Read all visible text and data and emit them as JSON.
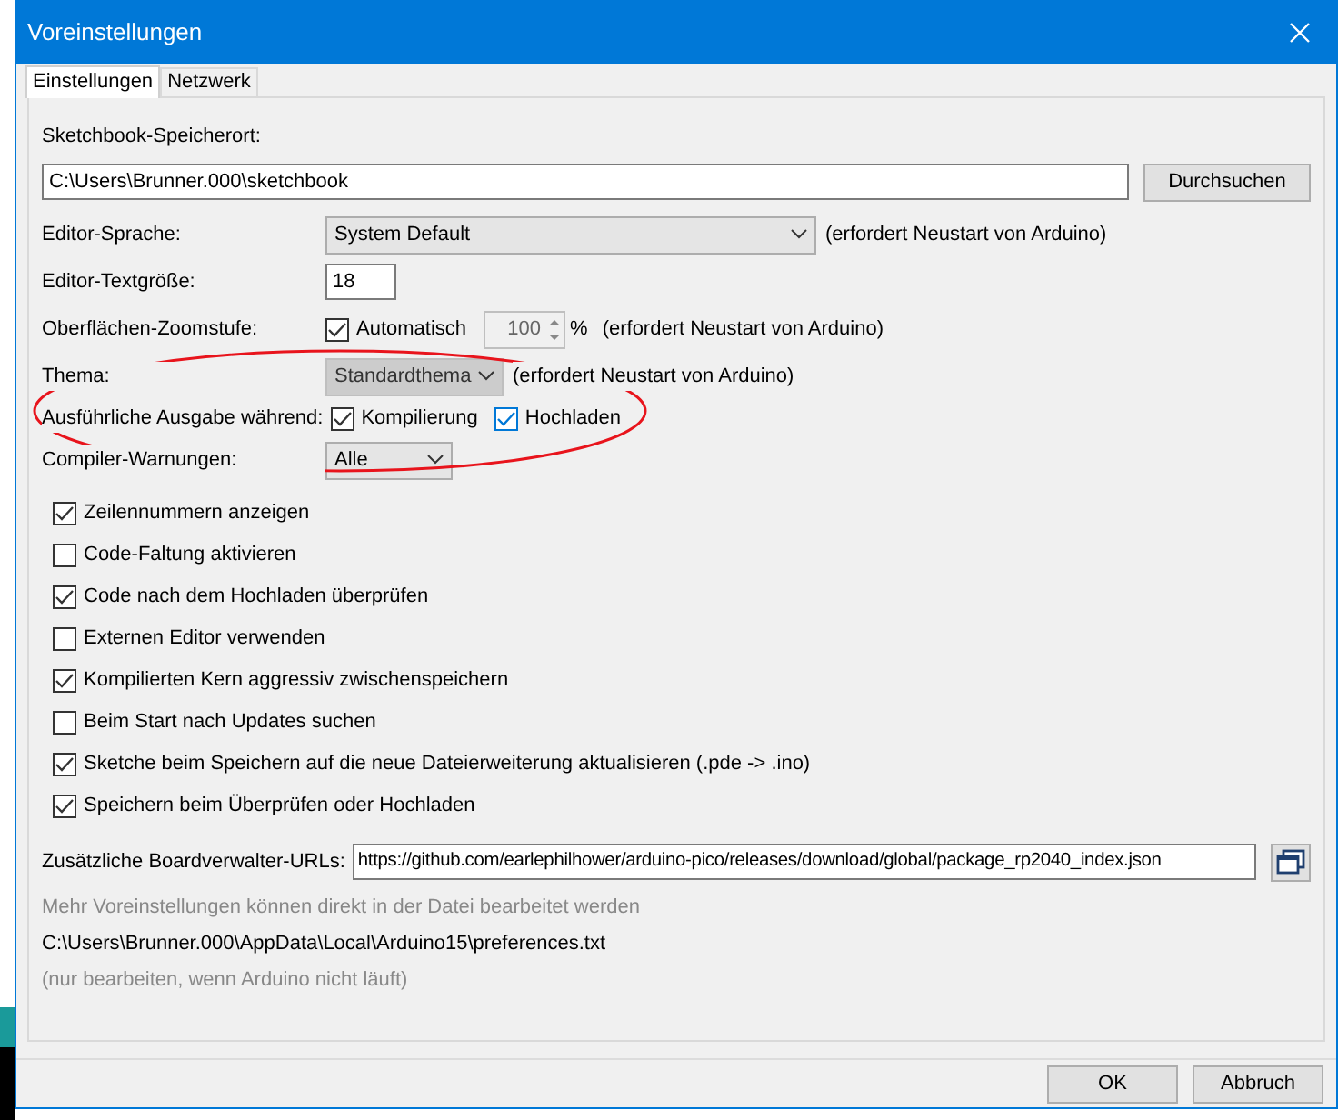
{
  "window": {
    "title": "Voreinstellungen"
  },
  "tabs": [
    {
      "label": "Einstellungen",
      "selected": true
    },
    {
      "label": "Netzwerk",
      "selected": false
    }
  ],
  "sketchbook": {
    "label": "Sketchbook-Speicherort:",
    "value": "C:\\Users\\Brunner.000\\sketchbook",
    "button": "Durchsuchen"
  },
  "rows": [
    {
      "kind": "select",
      "label": "Editor-Sprache:",
      "value": "System Default",
      "disabled": false,
      "note": "(erfordert Neustart von Arduino)"
    },
    {
      "kind": "text",
      "label": "Editor-Textgröße:",
      "value": "18"
    },
    {
      "kind": "zoom",
      "label": "Oberflächen-Zoomstufe:",
      "check": {
        "label": "Automatisch",
        "checked": true
      },
      "value": "100",
      "unit": "%",
      "note": "(erfordert Neustart von Arduino)"
    },
    {
      "kind": "select",
      "label": "Thema:",
      "value": "Standardthema",
      "disabled": true,
      "note": "(erfordert Neustart von Arduino)"
    },
    {
      "kind": "checks",
      "label": "Ausführliche Ausgabe während:",
      "checks": [
        {
          "label": "Kompilierung",
          "checked": true,
          "focused": false
        },
        {
          "label": "Hochladen",
          "checked": true,
          "focused": true
        }
      ]
    },
    {
      "kind": "select",
      "label": "Compiler-Warnungen:",
      "value": "Alle",
      "disabled": false
    }
  ],
  "options": [
    {
      "label": "Zeilennummern anzeigen",
      "checked": true
    },
    {
      "label": "Code-Faltung aktivieren",
      "checked": false
    },
    {
      "label": "Code nach dem Hochladen überprüfen",
      "checked": true
    },
    {
      "label": "Externen Editor verwenden",
      "checked": false
    },
    {
      "label": "Kompilierten Kern aggressiv zwischenspeichern",
      "checked": true
    },
    {
      "label": "Beim Start nach Updates suchen",
      "checked": false
    },
    {
      "label": "Sketche beim Speichern auf die neue Dateierweiterung aktualisieren (.pde -> .ino)",
      "checked": true
    },
    {
      "label": "Speichern beim Überprüfen oder Hochladen",
      "checked": true
    }
  ],
  "board_urls": {
    "label": "Zusätzliche Boardverwalter-URLs:",
    "value": "https://github.com/earlephilhower/arduino-pico/releases/download/global/package_rp2040_index.json"
  },
  "info": {
    "hint": "Mehr Voreinstellungen können direkt in der Datei bearbeitet werden",
    "path": "C:\\Users\\Brunner.000\\AppData\\Local\\Arduino15\\preferences.txt",
    "note": "(nur bearbeiten, wenn Arduino nicht läuft)"
  },
  "buttons": [
    "OK",
    "Abbruch"
  ]
}
